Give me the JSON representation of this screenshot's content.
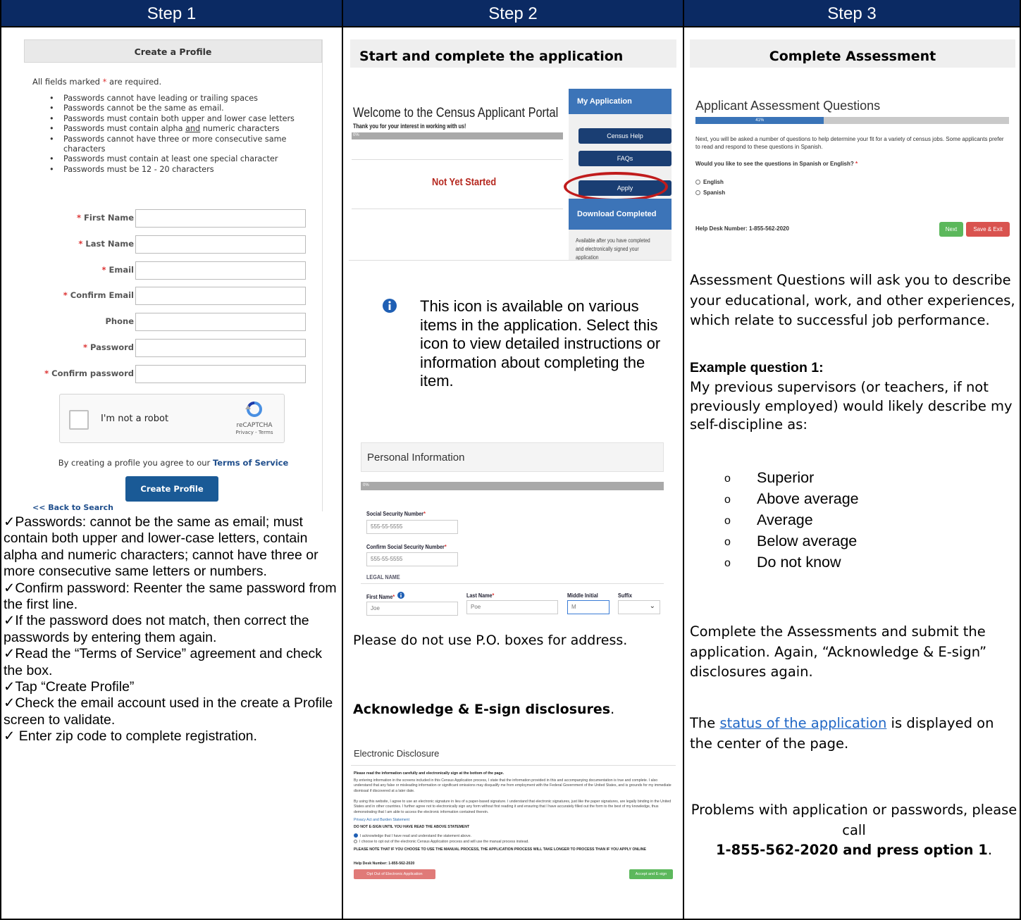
{
  "headers": {
    "step1": "Step 1",
    "step2": "Step 2",
    "step3": "Step 3"
  },
  "step1": {
    "form_title": "Create a Profile",
    "required_pre": "All fields marked ",
    "required_star": "*",
    "required_post": " are required.",
    "rules": [
      "Passwords cannot have leading or trailing spaces",
      "Passwords cannot be the same as email.",
      "Passwords must contain both upper and lower case letters",
      "Passwords must contain alpha",
      "and",
      "numeric characters",
      "Passwords cannot have three or more consecutive same characters",
      "Passwords must contain at least one special character",
      "Passwords must be 12 - 20 characters"
    ],
    "fields": [
      {
        "label": "First Name",
        "required": "*"
      },
      {
        "label": "Last Name",
        "required": "*"
      },
      {
        "label": "Email",
        "required": "*"
      },
      {
        "label": "Confirm Email",
        "required": "*"
      },
      {
        "label": "Phone",
        "required": ""
      },
      {
        "label": "Password",
        "required": "*"
      },
      {
        "label": "Confirm password",
        "required": "*"
      }
    ],
    "captcha_text": "I'm not a robot",
    "captcha_brand": "reCAPTCHA",
    "captcha_links": "Privacy - Terms",
    "terms_pre": "By creating a profile you agree to our ",
    "terms_link": "Terms of Service",
    "create_button": "Create Profile",
    "back_link": "<< Back to Search",
    "notes": [
      "✓Passwords: cannot be the same as email; must contain both upper and lower-case letters, contain alpha and numeric characters; cannot have three or more consecutive same letters or numbers.",
      "✓Confirm password: Reenter the same password from the first line.",
      "✓If the password does not match, then correct the passwords by entering them again.",
      "✓Read the “Terms of Service” agreement and check the box.",
      "✓Tap “Create Profile”",
      "✓Check the email account used in the create a Profile screen to validate.",
      "✓ Enter zip code to complete registration."
    ]
  },
  "step2": {
    "heading": "Start and complete the application",
    "portal": {
      "title": "Welcome to the Census Applicant Portal",
      "subtitle": "Thank you for your interest in working with us!",
      "progress_label": "0%",
      "progress": 0,
      "status": "Not Yet Started",
      "side_header": "My Application",
      "buttons": [
        "Census Help",
        "FAQs",
        "Apply"
      ],
      "download_header": "Download Completed Forms",
      "download_note": "Available after you have completed and electronically signed your application"
    },
    "info_text": "This icon is available on various items in the application.  Select this icon to view detailed instructions or information about completing the item.",
    "personal": {
      "title": "Personal Information",
      "progress_label": "0%",
      "ssn_label": "Social Security Number",
      "ssn_value": "555-55-5555",
      "confirm_ssn_label": "Confirm Social Security Number",
      "confirm_ssn_value": "555-55-5555",
      "legal_name": "LEGAL NAME",
      "first_label": "First Name",
      "first_value": "Joe",
      "last_label": "Last Name",
      "last_value": "Poe",
      "middle_label": "Middle Initial",
      "middle_value": "M",
      "suffix_label": "Suffix",
      "star": "*"
    },
    "po_box": "Please do not use P.O. boxes for address.",
    "ack": "Acknowledge & E-sign disclosures",
    "ack_period": ".",
    "disclosure": {
      "title": "Electronic Disclosure",
      "p0": "Please read the information carefully and electronically sign at the bottom of the page.",
      "p1": "By entering information in the screens included in this Census Application process, I state that the information provided in this and accompanying documentation is true and complete. I also understand that any false or misleading information or significant omissions may disqualify me from employment with the Federal Government of the United States, and is grounds for my immediate dismissal if discovered at a later date.",
      "p2": "By using this website, I agree to use an electronic signature in lieu of a paper-based signature. I understand that electronic signatures, just like the paper signatures, are legally binding in the United States and in other countries. I further agree not to electronically sign any form without first reading it and ensuring that I have accurately filled out the form to the best of my knowledge, thus demonstrating that I am able to access the electronic information contained therein.",
      "link": "Privacy Act and Burden Statement",
      "warn": "DO NOT E-SIGN UNTIL YOU HAVE READ THE ABOVE STATEMENT",
      "r1": "I acknowledge that I have read and understand the statement above.",
      "r2": "I choose to opt out of the electronic Census Application process and will use the manual process instead.",
      "note": "PLEASE NOTE THAT IF YOU CHOOSE TO USE THE MANUAL PROCESS, THE APPLICATION PROCESS WILL TAKE LONGER TO PROCESS THAN IF YOU APPLY ONLINE",
      "help": "Help Desk Number: 1-855-562-2020",
      "opt_out": "Opt Out of Electronic Application",
      "accept": "Accept and E-sign"
    }
  },
  "step3": {
    "heading": "Complete Assessment",
    "shot": {
      "title": "Applicant Assessment Questions",
      "progress_label": "41%",
      "progress": 0.41,
      "intro": "Next, you will be asked a number of questions to help determine your fit for a variety of census jobs. Some applicants prefer to read and respond to these questions in Spanish.",
      "question": "Would you like to see the questions in Spanish or English?",
      "star": "*",
      "options": [
        "English",
        "Spanish"
      ],
      "help": "Help Desk Number: 1-855-562-2020",
      "next": "Next",
      "save_exit": "Save & Exit"
    },
    "p1": "Assessment Questions will ask you to describe your educational, work, and other experiences, which relate to successful job performance.",
    "example_heading": "Example question 1:",
    "example": "My previous supervisors (or teachers, if not previously employed) would likely describe my self-discipline as:",
    "example_options": [
      "Superior",
      "Above average",
      "Average",
      "Below average",
      "Do not know"
    ],
    "p2": "Complete the Assessments and submit the application.  Again, “Acknowledge & E-sign” disclosures again.",
    "p3_pre": "The ",
    "p3_link": "status of the application",
    "p3_post": " is displayed on the center of the page.",
    "p4": "Problems with application or passwords, please call",
    "p4_bold": "1-855-562-2020 and press option 1",
    "p4_end": "."
  },
  "colors": {
    "header_bg": "#0b2a63",
    "link": "#1f66c5",
    "required": "#d33",
    "oval": "#c01c1c",
    "next_btn": "#5cb85c",
    "save_btn": "#d9534f"
  }
}
